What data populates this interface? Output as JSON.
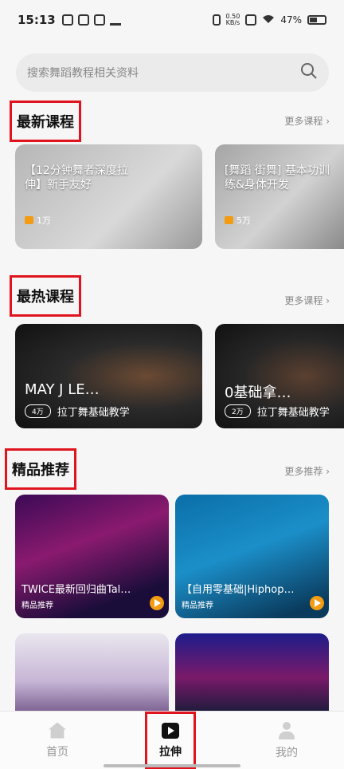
{
  "status_bar": {
    "time": "15:13",
    "net_rate": "0.50",
    "net_unit": "KB/s",
    "battery": "47%"
  },
  "search": {
    "placeholder": "搜索舞蹈教程相关资料"
  },
  "sections": {
    "latest": {
      "title": "最新课程",
      "more": "更多课程 ›"
    },
    "hot": {
      "title": "最热课程",
      "more": "更多课程 ›"
    },
    "recommend": {
      "title": "精品推荐",
      "more": "更多推荐 ›"
    }
  },
  "latest_cards": [
    {
      "title": "【12分钟舞者深度拉伸】新手友好",
      "count": "1万"
    },
    {
      "title": "[舞蹈 街舞] 基本功训练&身体开发",
      "count": "5万"
    }
  ],
  "hot_cards": [
    {
      "title": "MAY J LE…",
      "count": "4万",
      "subtitle": "拉丁舞基础教学"
    },
    {
      "title": "0基础拿…",
      "count": "2万",
      "subtitle": "拉丁舞基础教学"
    }
  ],
  "recommend_cards": [
    {
      "title": "TWICE最新回归曲Tal…",
      "tag": "精品推荐"
    },
    {
      "title": "【自用零基础|Hiphop…",
      "tag": "精品推荐"
    }
  ],
  "tabs": [
    {
      "label": "首页",
      "icon": "home-icon"
    },
    {
      "label": "拉伸",
      "icon": "play-icon"
    },
    {
      "label": "我的",
      "icon": "user-icon"
    }
  ],
  "colors": {
    "accent": "#e0141e",
    "badge": "#f39c12"
  }
}
